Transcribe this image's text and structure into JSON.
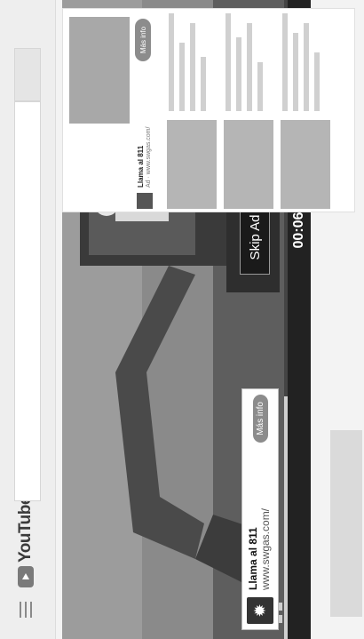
{
  "header": {
    "brand": "YouTube",
    "menu_icon": "hamburger-menu-icon",
    "logo_icon": "youtube-play-icon"
  },
  "player": {
    "ad": {
      "title": "Llama al 811",
      "url": "www.swgas.com/",
      "more_info": "Más info",
      "logo_icon": "swgas-flame-icon"
    },
    "skip_label": "Skip Ad",
    "skip_icon": "skip-next-icon",
    "time": "00:06",
    "pause_icon": "pause-icon",
    "progress": 0.38
  },
  "sidebar_ad": {
    "title": "Llama al 811",
    "subtitle": "Ad · www.swgas.com/",
    "more_info": "Más info"
  },
  "colors": {
    "bar": "#222222",
    "accent": "#8c8c8c"
  }
}
